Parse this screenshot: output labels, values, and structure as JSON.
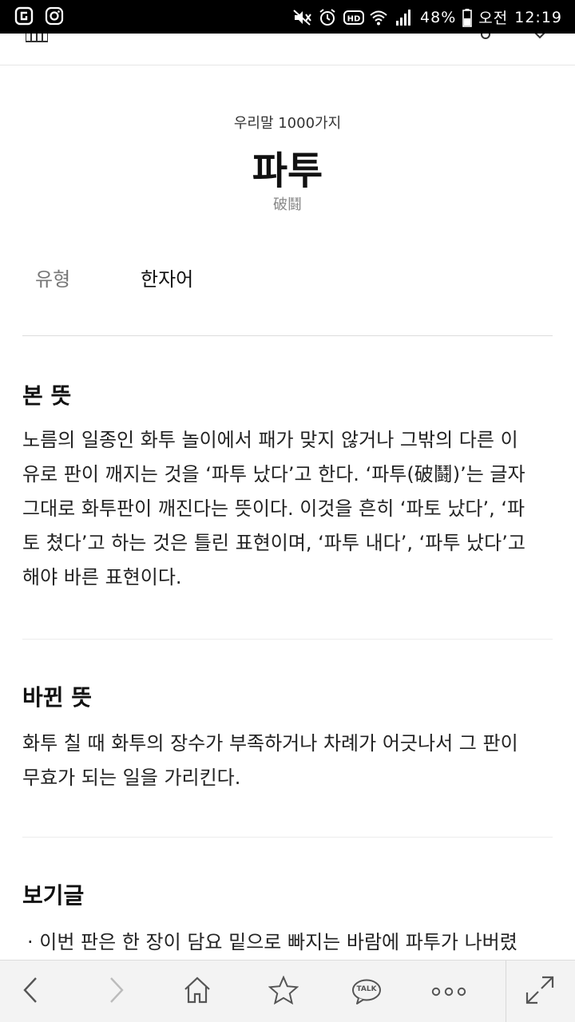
{
  "status_bar": {
    "battery": "48%",
    "time_label": "오전",
    "time": "12:19",
    "left_icons": [
      "notification-app-icon",
      "instagram-icon"
    ],
    "right_icons": [
      "mute-icon",
      "alarm-icon",
      "hd-icon",
      "wifi-icon",
      "signal-icon",
      "battery-icon"
    ]
  },
  "header": {
    "category": "우리말 1000가지",
    "title": "파투",
    "hanja": "破鬪",
    "type_label": "유형",
    "type_value": "한자어"
  },
  "sections": {
    "original_meaning": {
      "title": "본 뜻",
      "lines": [
        "노름의 일종인 화투 놀이에서 패가 맞지 않거나 그밖의 다른 이",
        "유로 판이 깨지는 것을 ‘파투 났다’고 한다. ‘파투(破鬪)’는 글자",
        "그대로 화투판이 깨진다는 뜻이다. 이것을 흔히 ‘파토 났다’, ‘파",
        "토 쳤다’고 하는 것은 틀린 표현이며, ‘파투 내다’, ‘파투 났다’고",
        "해야 바른 표현이다."
      ]
    },
    "changed_meaning": {
      "title": "바뀐 뜻",
      "lines": [
        "화투 칠 때 화투의 장수가 부족하거나 차례가 어긋나서 그 판이",
        "무효가 되는 일을 가리킨다."
      ]
    },
    "examples": {
      "title": "보기글",
      "items": [
        "· 이번 판은 한 장이 담요 밑으로 빠지는 바람에 파투가 나버렸"
      ]
    }
  },
  "toolbar": {
    "buttons": [
      "back-icon",
      "forward-icon",
      "home-icon",
      "bookmark-star-icon",
      "kakaotalk-icon",
      "more-icon",
      "expand-icon"
    ],
    "talk_label": "TALK"
  },
  "colors": {
    "status_bar_bg": "#000000",
    "toolbar_bg": "#f3f3f3",
    "divider": "#dcdcdc",
    "text": "#222222",
    "muted": "#888888"
  }
}
